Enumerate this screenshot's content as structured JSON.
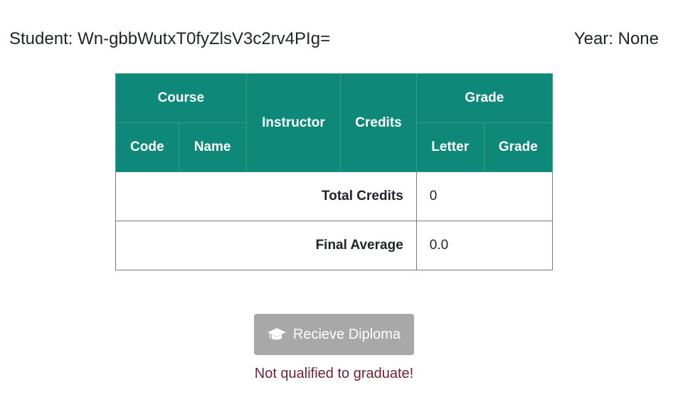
{
  "header": {
    "student_label": "Student: Wn-gbbWutxT0fyZlsV3c2rv4PIg=",
    "year_label": "Year: None"
  },
  "table": {
    "headers": {
      "course": "Course",
      "code": "Code",
      "name": "Name",
      "instructor": "Instructor",
      "credits": "Credits",
      "grade_group": "Grade",
      "letter": "Letter",
      "grade": "Grade"
    },
    "rows": [],
    "footer": {
      "total_credits_label": "Total Credits",
      "total_credits_value": "0",
      "final_average_label": "Final Average",
      "final_average_value": "0.0"
    }
  },
  "diploma_button": {
    "label": "Recieve Diploma",
    "icon": "graduation-cap-icon",
    "disabled": true
  },
  "status_message": "Not qualified to graduate!",
  "colors": {
    "header_bg": "#0e8878",
    "button_disabled": "#a8a8a8",
    "status_text": "#6b2433"
  }
}
